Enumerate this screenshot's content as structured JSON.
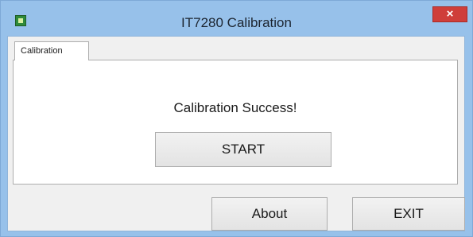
{
  "window": {
    "title": "IT7280 Calibration",
    "close_label": "×",
    "accent_color": "#97c1ea",
    "close_color": "#cf3e3a",
    "icon": "app-icon"
  },
  "tabs": [
    {
      "label": "Calibration",
      "selected": true
    }
  ],
  "panel": {
    "status_text": "Calibration Success!",
    "start_label": "START"
  },
  "footer": {
    "about_label": "About",
    "exit_label": "EXIT"
  }
}
